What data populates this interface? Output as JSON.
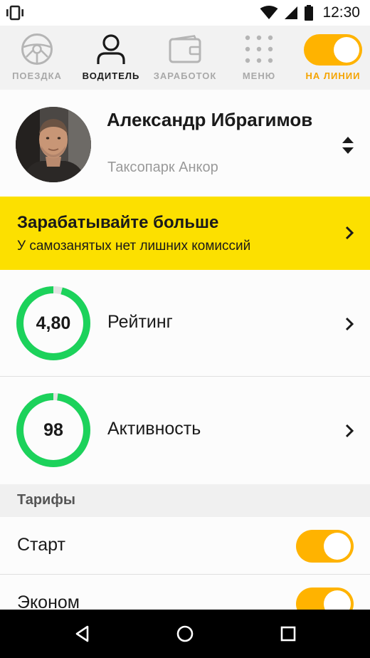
{
  "status_bar": {
    "time": "12:30",
    "icons": [
      "vibrate-icon",
      "wifi-icon",
      "signal-icon",
      "battery-icon"
    ]
  },
  "top_nav": {
    "items": [
      {
        "label": "ПОЕЗДКА",
        "icon": "steering-wheel-icon"
      },
      {
        "label": "ВОДИТЕЛЬ",
        "icon": "driver-icon",
        "active": true
      },
      {
        "label": "ЗАРАБОТОК",
        "icon": "wallet-icon"
      },
      {
        "label": "МЕНЮ",
        "icon": "grid-menu-icon"
      },
      {
        "label": "НА ЛИНИИ",
        "icon": "online-toggle",
        "on": true
      }
    ]
  },
  "profile": {
    "name": "Александр Ибрагимов",
    "park": "Таксопарк Анкор"
  },
  "banner": {
    "title": "Зарабатывайте больше",
    "subtitle": "У самозанятых нет лишних комиссий"
  },
  "stats": [
    {
      "value": "4,80",
      "label": "Рейтинг",
      "progress": 0.96
    },
    {
      "value": "98",
      "label": "Активность",
      "progress": 0.98
    }
  ],
  "tariffs": {
    "title": "Тарифы",
    "items": [
      {
        "label": "Старт",
        "on": true
      },
      {
        "label": "Эконом",
        "on": true
      }
    ]
  },
  "colors": {
    "accent_yellow": "#fce000",
    "toggle_orange": "#ffb300",
    "ring_green": "#1cd25b",
    "ring_track": "#e3e3e3"
  }
}
